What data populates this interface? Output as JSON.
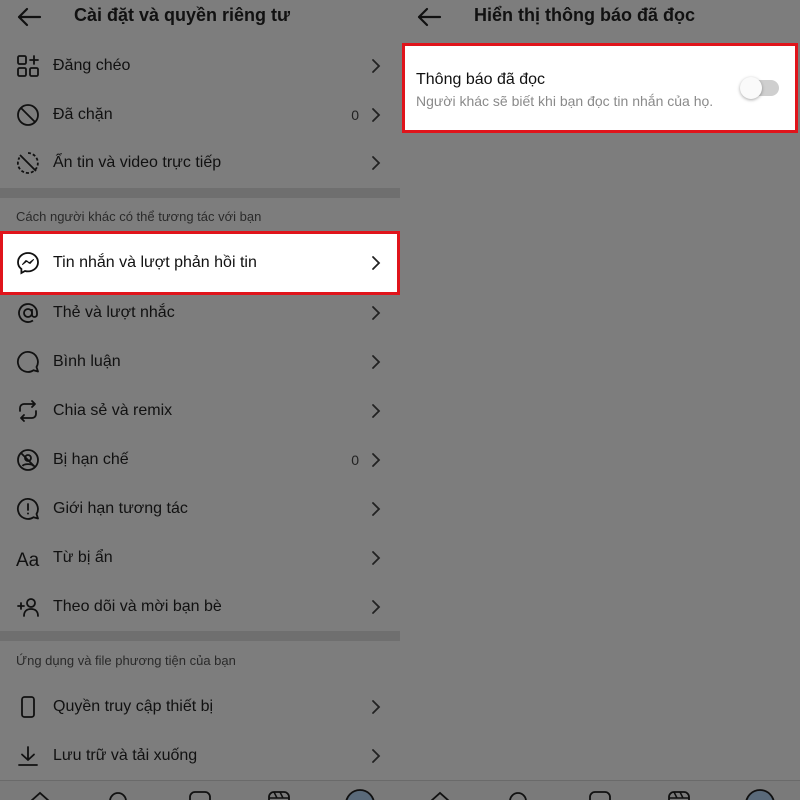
{
  "left": {
    "title": "Cài đặt và quyền riêng tư",
    "group1": [
      {
        "id": "crosspost",
        "label": "Đăng chéo",
        "icon": "grid-plus-icon",
        "count": ""
      },
      {
        "id": "blocked",
        "label": "Đã chặn",
        "icon": "block-icon",
        "count": "0"
      },
      {
        "id": "hide-story",
        "label": "Ẩn tin và video trực tiếp",
        "icon": "hide-story-icon",
        "count": ""
      }
    ],
    "section1": "Cách người khác có thể tương tác với bạn",
    "highlighted_item": {
      "label": "Tin nhắn và lượt phản hồi tin",
      "icon": "messenger-icon"
    },
    "group2": [
      {
        "id": "tags",
        "label": "Thẻ và lượt nhắc",
        "icon": "at-sign-icon",
        "count": ""
      },
      {
        "id": "comments",
        "label": "Bình luận",
        "icon": "comment-icon",
        "count": ""
      },
      {
        "id": "sharing",
        "label": "Chia sẻ và remix",
        "icon": "share-remix-icon",
        "count": ""
      },
      {
        "id": "restricted",
        "label": "Bị hạn chế",
        "icon": "restricted-icon",
        "count": "0"
      },
      {
        "id": "limits",
        "label": "Giới hạn tương tác",
        "icon": "alert-icon",
        "count": ""
      },
      {
        "id": "hidden-words",
        "label": "Từ bị ẩn",
        "icon": "text-aa-icon",
        "count": ""
      },
      {
        "id": "follow-invite",
        "label": "Theo dõi và mời bạn bè",
        "icon": "add-person-icon",
        "count": ""
      }
    ],
    "section2": "Ứng dụng và file phương tiện của bạn",
    "group3": [
      {
        "id": "device-access",
        "label": "Quyền truy cập thiết bị",
        "icon": "phone-icon",
        "count": ""
      },
      {
        "id": "archive-download",
        "label": "Lưu trữ và tải xuống",
        "icon": "download-icon",
        "count": ""
      }
    ]
  },
  "right": {
    "title": "Hiển thị thông báo đã đọc",
    "setting_title": "Thông báo đã đọc",
    "setting_desc": "Người khác sẽ biết khi bạn đọc tin nhắn của họ.",
    "toggle_on": false
  },
  "colors": {
    "overlay": "#7d7d7d",
    "highlight_border": "#e0141b"
  }
}
